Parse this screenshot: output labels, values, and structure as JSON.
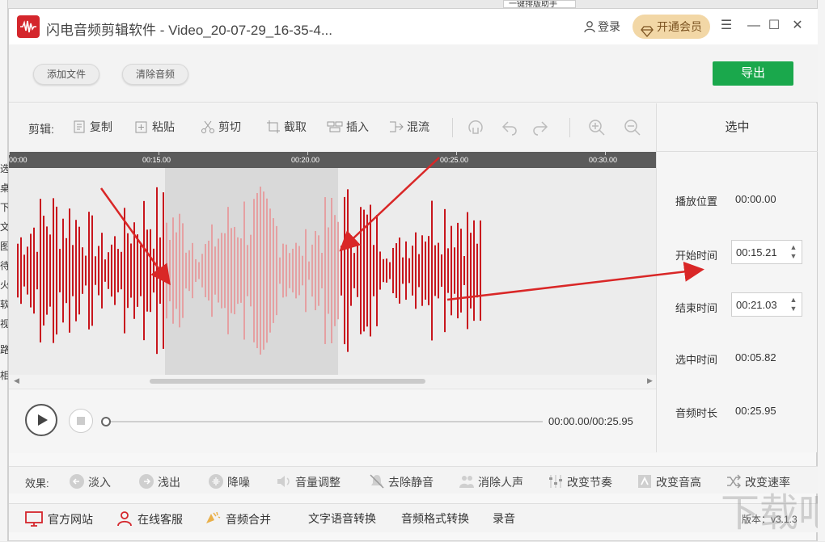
{
  "app": {
    "title": "闪电音频剪辑软件 - Video_20-07-29_16-35-4...",
    "login": "登录",
    "vip": "开通会员"
  },
  "file_bar": {
    "add_file": "添加文件",
    "clear_audio": "清除音频",
    "export": "导出"
  },
  "edit_bar": {
    "label": "剪辑:",
    "tools": [
      "复制",
      "粘贴",
      "剪切",
      "截取",
      "插入",
      "混流"
    ]
  },
  "timeline": {
    "ticks": [
      "00:00",
      "00:15.00",
      "00:20.00",
      "00:25.00",
      "00:30.00"
    ]
  },
  "right_panel": {
    "title": "选中",
    "play_position_label": "播放位置",
    "play_position": "00:00.00",
    "start_label": "开始时间",
    "start_value": "00:15.21",
    "end_label": "结束时间",
    "end_value": "00:21.03",
    "selected_label": "选中时间",
    "selected_value": "00:05.82",
    "duration_label": "音频时长",
    "duration_value": "00:25.95"
  },
  "player": {
    "time": "00:00.00/00:25.95",
    "progress": 0
  },
  "effects": {
    "label": "效果:",
    "items": [
      "淡入",
      "浅出",
      "降噪",
      "音量调整",
      "去除静音",
      "消除人声",
      "改变节奏",
      "改变音高",
      "改变速率"
    ]
  },
  "bottom": {
    "website": "官方网站",
    "service": "在线客服",
    "merge": "音频合并",
    "tts": "文字语音转换",
    "convert": "音频格式转换",
    "record": "录音",
    "version": "版本：v3.1.3"
  },
  "background": {
    "top_tab": "一键排版助手",
    "left_chars": [
      "选",
      "桌",
      "下",
      "文",
      "图",
      "待",
      "火",
      "软",
      "视",
      "路",
      "相"
    ]
  },
  "colors": {
    "wave": "#c8161d",
    "wave_selected": "#e5a0a2",
    "export": "#1aa84c",
    "vip": "#f2d7a6",
    "arrow": "#d92727"
  }
}
